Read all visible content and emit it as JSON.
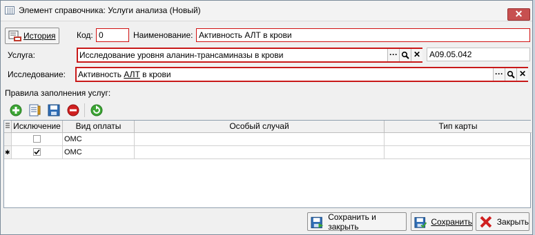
{
  "window": {
    "title": "Элемент справочника: Услуги анализа (Новый)",
    "close_glyph": "✕"
  },
  "form": {
    "history_label": "История",
    "code_label": "Код:",
    "code_value": "0",
    "name_label": "Наименование:",
    "name_value": "Активность АЛТ в крови",
    "service_label": "Услуга:",
    "service_value": "Исследование уровня аланин-трансаминазы в крови",
    "service_code": "A09.05.042",
    "study_label": "Исследование:",
    "study_value_prefix": "Активность ",
    "study_value_link": "АЛТ",
    "study_value_suffix": " в крови",
    "rules_label": "Правила заполнения услуг:"
  },
  "lookup": {
    "select_glyph": "···",
    "search_icon": "magnifier-icon",
    "clear_glyph": "✕"
  },
  "toolbar": {
    "icons": [
      "add-icon",
      "edit-icon",
      "save-icon",
      "delete-icon",
      "refresh-icon"
    ],
    "colors": {
      "add": "#3da635",
      "delete": "#d02020",
      "refresh": "#3da635"
    }
  },
  "grid": {
    "columns": [
      "Исключение",
      "Вид оплаты",
      "Особый случай",
      "Тип карты"
    ],
    "rows": [
      {
        "marker": "",
        "exclusion": false,
        "payment": "ОМС",
        "special": "",
        "card": ""
      },
      {
        "marker": "✱",
        "exclusion": true,
        "payment": "ОМС",
        "special": "",
        "card": ""
      }
    ]
  },
  "buttons": {
    "save_close": "Сохранить и закрыть",
    "save": "Сохранить",
    "close": "Закрыть"
  }
}
